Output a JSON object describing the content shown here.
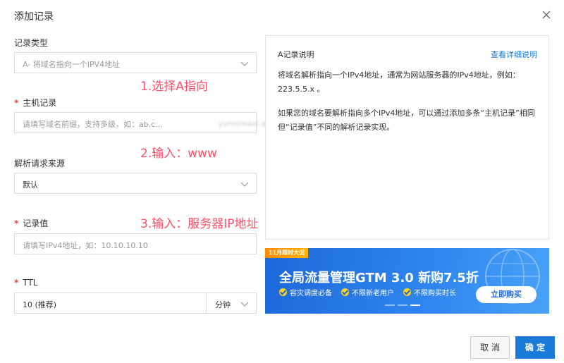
{
  "dialog": {
    "title": "添加记录"
  },
  "form": {
    "record_type": {
      "label": "记录类型",
      "value": "A- 将域名指向一个IPV4地址"
    },
    "host": {
      "required": "*",
      "label": "主机记录",
      "placeholder": "请填写域名前缀，支持多级，如：ab.c...",
      "domain_suffix": ".yunnimaxi.ae"
    },
    "source": {
      "label": "解析请求来源",
      "value": "默认"
    },
    "value": {
      "required": "*",
      "label": "记录值",
      "placeholder": "请填写IPv4地址，如：10.10.10.10"
    },
    "ttl": {
      "required": "*",
      "label": "TTL",
      "value": "10 (推荐)",
      "unit": "分钟"
    }
  },
  "annotations": {
    "step1": "1.选择A指向",
    "step2": "2.输入：www",
    "step3": "3.输入：服务器IP地址"
  },
  "info": {
    "title": "A记录说明",
    "link": "查看详细说明",
    "para1": "将域名解析指向一个IPv4地址，通常为网站服务器的IPv4地址，例如：223.5.5.x 。",
    "para2": "如果您的域名要解析指向多个IPv4地址，可以通过添加多条“主机记录”相同但“记录值”不同的解析记录实现。"
  },
  "banner": {
    "tag": "11月限时大促",
    "title": "全局流量管理GTM 3.0 新购7.5折",
    "features": [
      "容灾调度必备",
      "不限新老用户",
      "不限购买时长"
    ],
    "button": "立即购买"
  },
  "buttons": {
    "cancel": "取 消",
    "ok": "确 定"
  }
}
